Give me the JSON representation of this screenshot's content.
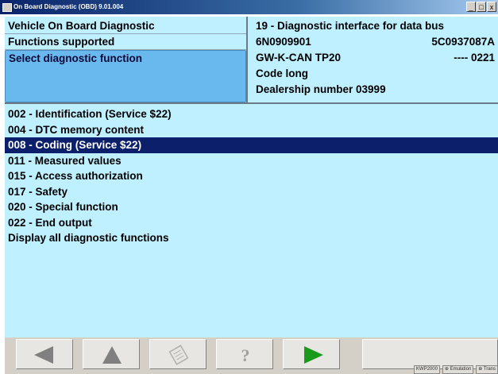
{
  "window": {
    "title": "On Board Diagnostic (OBD) 9.01.004",
    "buttons": {
      "minimize": "_",
      "restore": "□",
      "close": "x"
    }
  },
  "header_left": {
    "line1": "Vehicle On Board Diagnostic",
    "line2": "Functions supported",
    "line3": "Select diagnostic function"
  },
  "header_right": {
    "address": "19 - Diagnostic interface for data bus",
    "part_number": "6N0909901",
    "part_number_2": "5C0937087A",
    "component": "GW-K-CAN TP20",
    "version": "---- 0221",
    "coding": "Code long",
    "dealer": "Dealership number 03999"
  },
  "functions": [
    {
      "label": "002 - Identification (Service $22)",
      "selected": false
    },
    {
      "label": "004 - DTC memory content",
      "selected": false
    },
    {
      "label": "008 - Coding (Service $22)",
      "selected": true
    },
    {
      "label": "011 - Measured values",
      "selected": false
    },
    {
      "label": "015 - Access authorization",
      "selected": false
    },
    {
      "label": "017 - Safety",
      "selected": false
    },
    {
      "label": "020 - Special function",
      "selected": false
    },
    {
      "label": "022 - End output",
      "selected": false
    },
    {
      "label": "Display all diagnostic functions",
      "selected": false
    }
  ],
  "toolbar": {
    "buttons": [
      {
        "name": "back-button",
        "icon": "left-arrow-icon",
        "enabled": true
      },
      {
        "name": "up-button",
        "icon": "up-arrow-icon",
        "enabled": true
      },
      {
        "name": "print-button",
        "icon": "printer-icon",
        "enabled": false
      },
      {
        "name": "help-button",
        "icon": "question-mark-icon",
        "enabled": false
      },
      {
        "name": "continue-button",
        "icon": "right-arrow-icon",
        "enabled": true
      }
    ]
  },
  "status_bar": {
    "items": [
      "KWP2000",
      "⊕ Emulation",
      "⊕ Trans"
    ]
  },
  "colors": {
    "background": "#bff0ff",
    "selected_row": "#0b1f6b",
    "prompt_box": "#69b9ef",
    "continue_arrow": "#1a9a1a"
  }
}
